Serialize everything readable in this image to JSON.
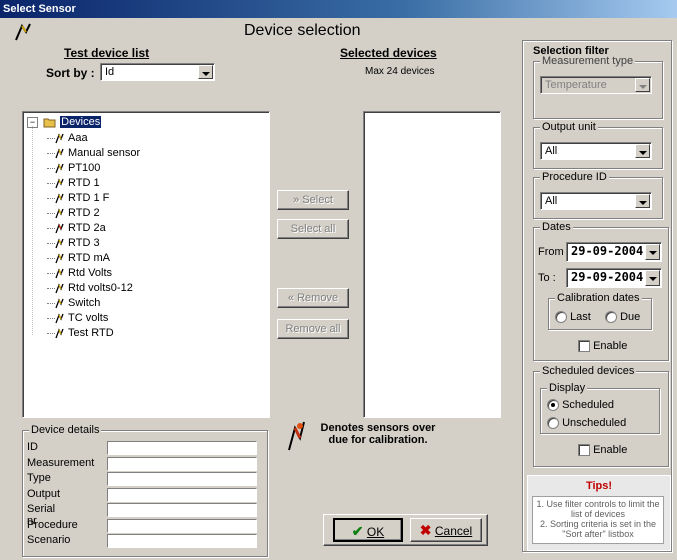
{
  "window": {
    "title": "Select Sensor"
  },
  "header": {
    "title": "Device selection"
  },
  "test_list": {
    "heading": "Test device list",
    "sort_label": "Sort by :",
    "sort_value": "Id",
    "tree_root": "Devices",
    "devices": [
      "Aaa",
      "Manual sensor",
      "PT100",
      "RTD 1",
      "RTD 1 F",
      "RTD 2",
      "RTD 2a",
      "RTD 3",
      "RTD mA",
      "Rtd Volts",
      "Rtd volts0-12",
      "Switch",
      "TC volts",
      "Test RTD"
    ]
  },
  "selected": {
    "heading": "Selected devices",
    "max_text": "Max 24 devices"
  },
  "buttons": {
    "select": "Select",
    "select_all": "Select all",
    "remove": "Remove",
    "remove_all": "Remove all",
    "ok": "OK",
    "cancel": "Cancel"
  },
  "device_details": {
    "legend": "Device details",
    "fields": [
      "ID",
      "Measurement",
      "Type",
      "Output",
      "Serial nr",
      "Procedure",
      "Scenario"
    ]
  },
  "note": {
    "text": "Denotes sensors over due for calibration."
  },
  "filter": {
    "title": "Selection filter",
    "measurement_type": {
      "legend": "Measurement type",
      "value": "Temperature"
    },
    "output_unit": {
      "legend": "Output unit",
      "value": "All"
    },
    "procedure_id": {
      "legend": "Procedure ID",
      "value": "All"
    },
    "dates": {
      "legend": "Dates",
      "from_label": "From",
      "from_value": "29-09-2004",
      "to_label": "To :",
      "to_value": "29-09-2004",
      "calibration_legend": "Calibration dates",
      "last_label": "Last",
      "due_label": "Due",
      "enable_label": "Enable"
    },
    "scheduled": {
      "legend": "Scheduled devices",
      "display_legend": "Display",
      "scheduled_label": "Scheduled",
      "unscheduled_label": "Unscheduled",
      "enable_label": "Enable"
    }
  },
  "tips": {
    "title": "Tips!",
    "lines": [
      "1. Use filter controls to limit the list of devices",
      "2. Sorting criteria is set in the \"Sort after\" listbox"
    ]
  },
  "colors": {
    "title_bar": "#0a246a",
    "tips_title": "#c00000",
    "face": "#d4d0c8"
  }
}
